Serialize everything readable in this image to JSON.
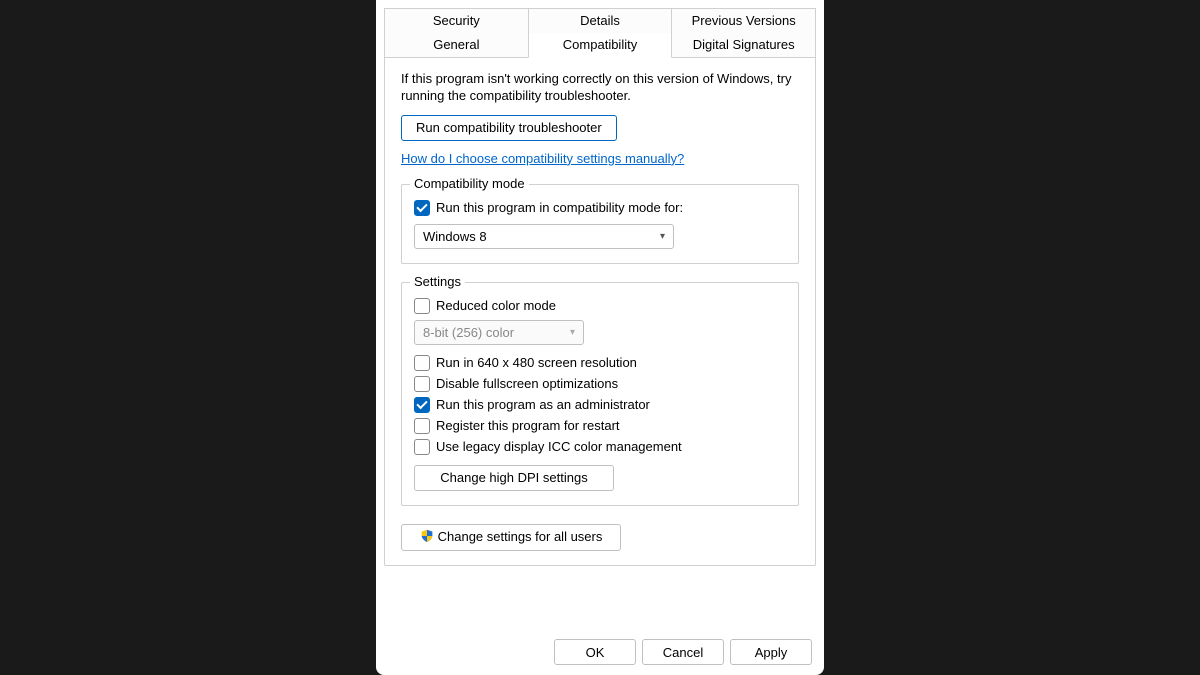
{
  "tabs": {
    "row1": [
      "Security",
      "Details",
      "Previous Versions"
    ],
    "row2": [
      "General",
      "Compatibility",
      "Digital Signatures"
    ],
    "active": "Compatibility"
  },
  "intro": "If this program isn't working correctly on this version of Windows, try running the compatibility troubleshooter.",
  "troubleshooter_button": "Run compatibility troubleshooter",
  "help_link": "How do I choose compatibility settings manually?",
  "compat_mode": {
    "legend": "Compatibility mode",
    "checkbox_label": "Run this program in compatibility mode for:",
    "checkbox_checked": true,
    "selected": "Windows 8"
  },
  "settings": {
    "legend": "Settings",
    "reduced_color": {
      "label": "Reduced color mode",
      "checked": false
    },
    "color_depth_selected": "8-bit (256) color",
    "run_640x480": {
      "label": "Run in 640 x 480 screen resolution",
      "checked": false
    },
    "disable_fullscreen": {
      "label": "Disable fullscreen optimizations",
      "checked": false
    },
    "run_admin": {
      "label": "Run this program as an administrator",
      "checked": true
    },
    "register_restart": {
      "label": "Register this program for restart",
      "checked": false
    },
    "legacy_icc": {
      "label": "Use legacy display ICC color management",
      "checked": false
    },
    "dpi_button": "Change high DPI settings"
  },
  "change_all_users": "Change settings for all users",
  "dialog_buttons": {
    "ok": "OK",
    "cancel": "Cancel",
    "apply": "Apply"
  }
}
